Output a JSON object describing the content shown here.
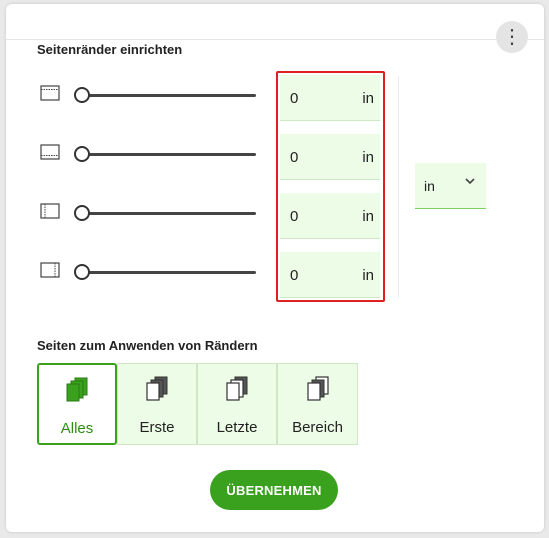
{
  "dialog": {
    "margins_title": "Seitenränder einrichten",
    "pages_title": "Seiten zum Anwenden von Rändern",
    "apply_label": "ÜBERNEHMEN"
  },
  "margins": [
    {
      "name": "top",
      "icon": "top-margin-icon",
      "value": "0",
      "unit": "in",
      "slider_fraction": 0
    },
    {
      "name": "bottom",
      "icon": "bottom-margin-icon",
      "value": "0",
      "unit": "in",
      "slider_fraction": 0
    },
    {
      "name": "left",
      "icon": "left-margin-icon",
      "value": "0",
      "unit": "in",
      "slider_fraction": 0
    },
    {
      "name": "right",
      "icon": "right-margin-icon",
      "value": "0",
      "unit": "in",
      "slider_fraction": 0
    }
  ],
  "unit_select": {
    "value": "in"
  },
  "pages": {
    "options": [
      {
        "label": "Alles",
        "icon": "all-pages-icon",
        "selected": true
      },
      {
        "label": "Erste",
        "icon": "first-page-icon",
        "selected": false
      },
      {
        "label": "Letzte",
        "icon": "last-page-icon",
        "selected": false
      },
      {
        "label": "Bereich",
        "icon": "range-pages-icon",
        "selected": false
      }
    ]
  },
  "colors": {
    "accent": "#3aa11e",
    "field_bg": "#edfce6",
    "highlight_border": "#e02020"
  }
}
